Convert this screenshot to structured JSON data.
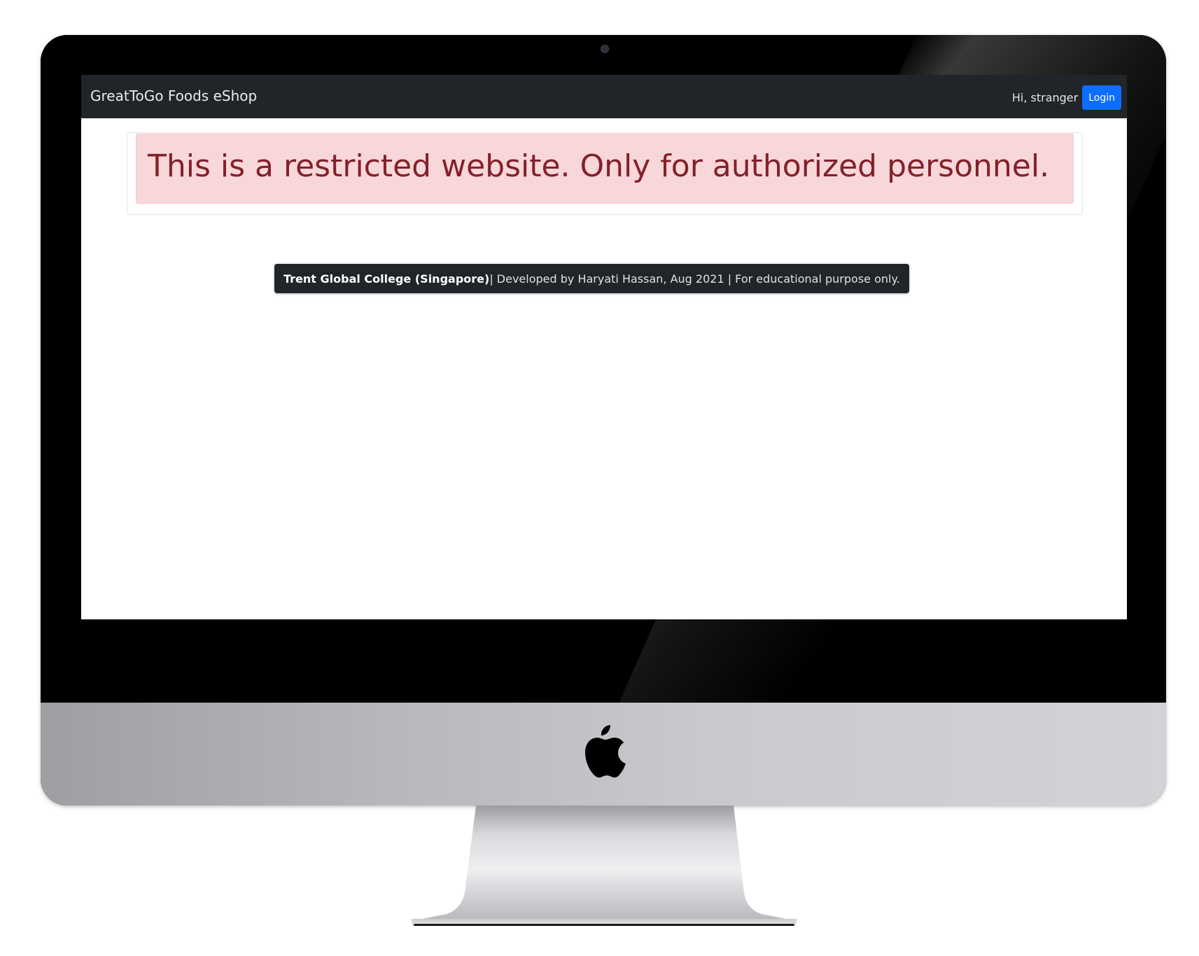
{
  "navbar": {
    "brand": "GreatToGo Foods eShop",
    "greeting": "Hi, stranger",
    "login_label": "Login"
  },
  "alert": {
    "message": "This is a restricted website. Only for authorized personnel."
  },
  "footer": {
    "organization": "Trent Global College (Singapore)",
    "details": " | Developed by Haryati Hassan, Aug 2021 | For educational purpose only."
  },
  "colors": {
    "navbar_bg": "#212529",
    "login_button": "#0d6efd",
    "alert_bg": "#f8d7da",
    "alert_text": "#842029"
  },
  "icons": {
    "brand_logo": "apple-logo-icon",
    "camera": "camera-icon"
  }
}
